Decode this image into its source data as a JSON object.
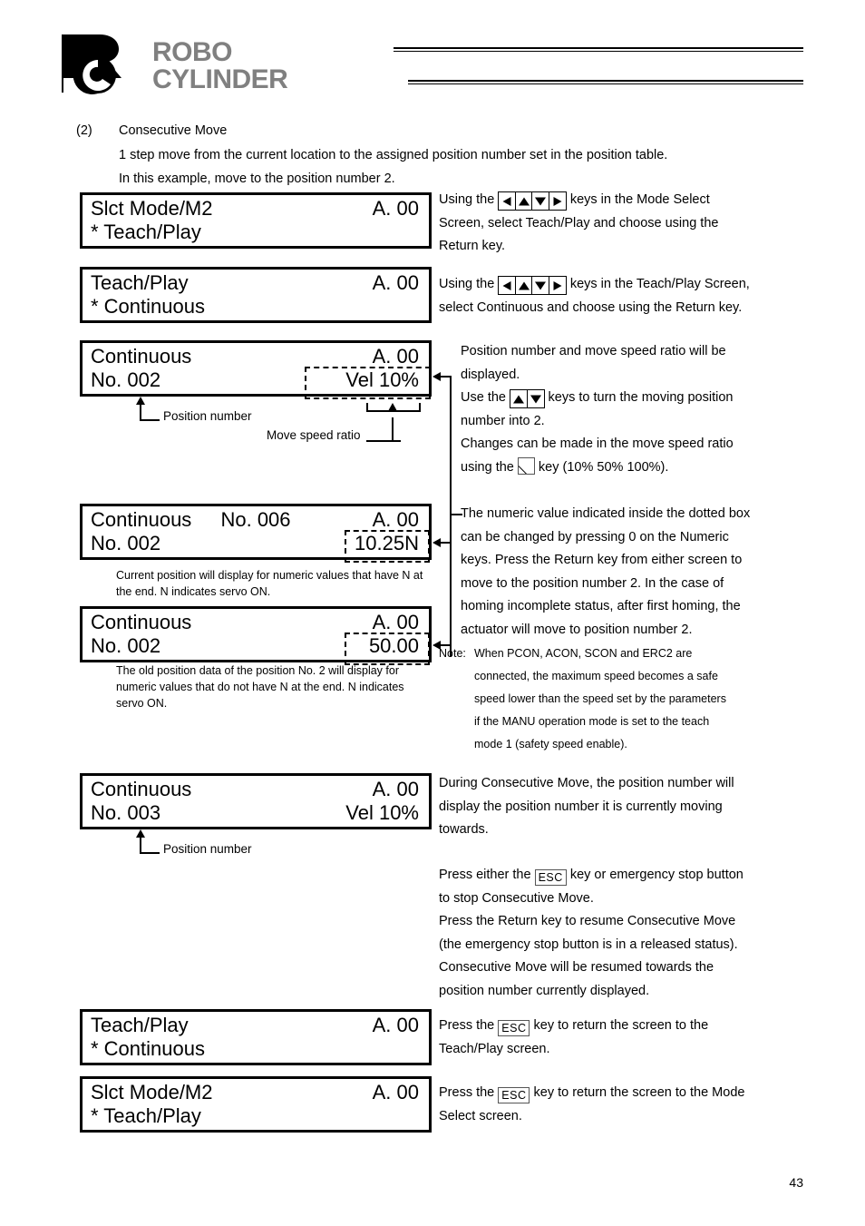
{
  "header": {
    "logo_mark": "rc-monogram",
    "logo_line1": "ROBO",
    "logo_line2": "CYLINDER"
  },
  "section": {
    "number": "(2)",
    "title": "Consecutive Move",
    "line1": "1 step move from the current location to the assigned position number set in the position table.",
    "line2": "In this example, move to the position number 2."
  },
  "screens": [
    {
      "id": "slct-mode-top",
      "top_left": "Slct Mode/M2",
      "top_right": "A. 00",
      "bottom_left": "* Teach/Play"
    },
    {
      "id": "teach-play-top",
      "top_left": "Teach/Play",
      "top_right": "A. 00",
      "bottom_left": "* Continuous"
    },
    {
      "id": "continuous-vel",
      "top_left": "Continuous",
      "top_right": "A. 00",
      "bottom_left": "No. 002",
      "bottom_right": "Vel 10%"
    },
    {
      "id": "continuous-force",
      "top_left": "Continuous",
      "top_mid": "No. 006",
      "top_right": "A. 00",
      "bottom_left": "No. 002",
      "bottom_right": "10.25N"
    },
    {
      "id": "continuous-pos",
      "top_left": "Continuous",
      "top_right": "A. 00",
      "bottom_left": "No. 002",
      "bottom_right": "50.00"
    },
    {
      "id": "continuous-moving",
      "top_left": "Continuous",
      "top_right": "A. 00",
      "bottom_left": "No. 003",
      "bottom_right": "Vel 10%"
    },
    {
      "id": "teach-play-bottom",
      "top_left": "Teach/Play",
      "top_right": "A. 00",
      "bottom_left": "* Continuous"
    },
    {
      "id": "slct-mode-bottom",
      "top_left": "Slct Mode/M2",
      "top_right": "A. 00",
      "bottom_left": "* Teach/Play"
    }
  ],
  "callouts": {
    "position_number_1": "Position number",
    "move_speed_ratio": "Move speed ratio",
    "position_number_2": "Position number",
    "note_force": "Current position will display for numeric values that have N at the end. N indicates servo ON.",
    "note_pos": "The old position data of the position No. 2 will display for numeric values that do not have N at the end. N indicates servo ON."
  },
  "descriptions": {
    "d1_a": "Using the",
    "d1_keys": [
      "left-arrow-key",
      "up-arrow-key",
      "down-arrow-key",
      "right-arrow-key"
    ],
    "d1_b": "keys in the Mode Select",
    "d1_c": "Screen, select Teach/Play and choose using the",
    "d1_d": "Return key.",
    "d2_a": "Using the",
    "d2_keys": [
      "left-arrow-key",
      "up-arrow-key",
      "down-arrow-key",
      "right-arrow-key"
    ],
    "d2_b": "keys in the Teach/Play Screen,",
    "d2_c": "select Continuous and choose using the Return key.",
    "d3_l1": "Position number and move speed ratio will be",
    "d3_l2": "displayed.",
    "d3_l3a": "Use the",
    "d3_l3b": "keys to turn the moving position",
    "d3_l4": "number into 2.",
    "d3_l5": "Changes can be made in the move speed ratio",
    "d3_l6a": "using the",
    "d3_l6b": "key (10% 50% 100%).",
    "d4_l1": "The numeric value indicated inside the dotted box",
    "d4_l2": "can be changed by pressing 0 on the Numeric",
    "d4_l3": "keys. Press the Return key from either screen to",
    "d4_l4": "move to the position number 2. In the case of",
    "d4_l5": "homing incomplete status, after first homing, the",
    "d4_l6": "actuator will move to position number 2.",
    "note_label": "Note:",
    "note_l1": "When PCON, ACON, SCON and ERC2 are",
    "note_l2": "connected, the maximum speed becomes a safe",
    "note_l3": "speed lower than the speed set by the parameters",
    "note_l4": "if the MANU operation mode is set to the teach",
    "note_l5": "mode 1 (safety speed enable).",
    "d5_l1": "During Consecutive Move, the position number will",
    "d5_l2": "display the position number it is currently moving",
    "d5_l3": "towards.",
    "d6_l1a": "Press either the",
    "d6_l1b": "key or emergency stop button",
    "d6_l2": "to stop Consecutive Move.",
    "d6_l3": "Press the Return key to resume Consecutive Move",
    "d6_l4": "(the emergency stop button is in a released status).",
    "d6_l5": "Consecutive Move will be resumed towards the",
    "d6_l6": "position number currently displayed.",
    "d7_l1a": "Press the",
    "d7_l1b": "key to return the screen to the",
    "d7_l2": "Teach/Play screen.",
    "d8_l1a": "Press the",
    "d8_l1b": "key to return the screen to the Mode",
    "d8_l2": "Select screen."
  },
  "esc_key_label": "ESC",
  "page_number": "43",
  "colors": {
    "ink": "#000000",
    "logo_gray": "#808080",
    "background": "#ffffff"
  }
}
